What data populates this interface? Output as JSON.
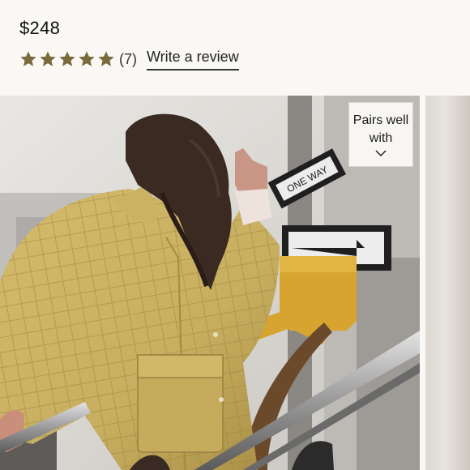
{
  "product": {
    "title_partial": "",
    "price": "$248"
  },
  "rating": {
    "stars": 5,
    "max_stars": 5,
    "count_label": "(7)",
    "star_color": "#7a6a3c",
    "write_review_label": "Write a review"
  },
  "gallery": {
    "pairs_well_with_label": "Pairs well with",
    "chevron_icon": "chevron-down-icon",
    "street_sign_text": "ONE WAY"
  },
  "colors": {
    "background": "#f9f8f5",
    "jacket": "#c8ae5f"
  }
}
